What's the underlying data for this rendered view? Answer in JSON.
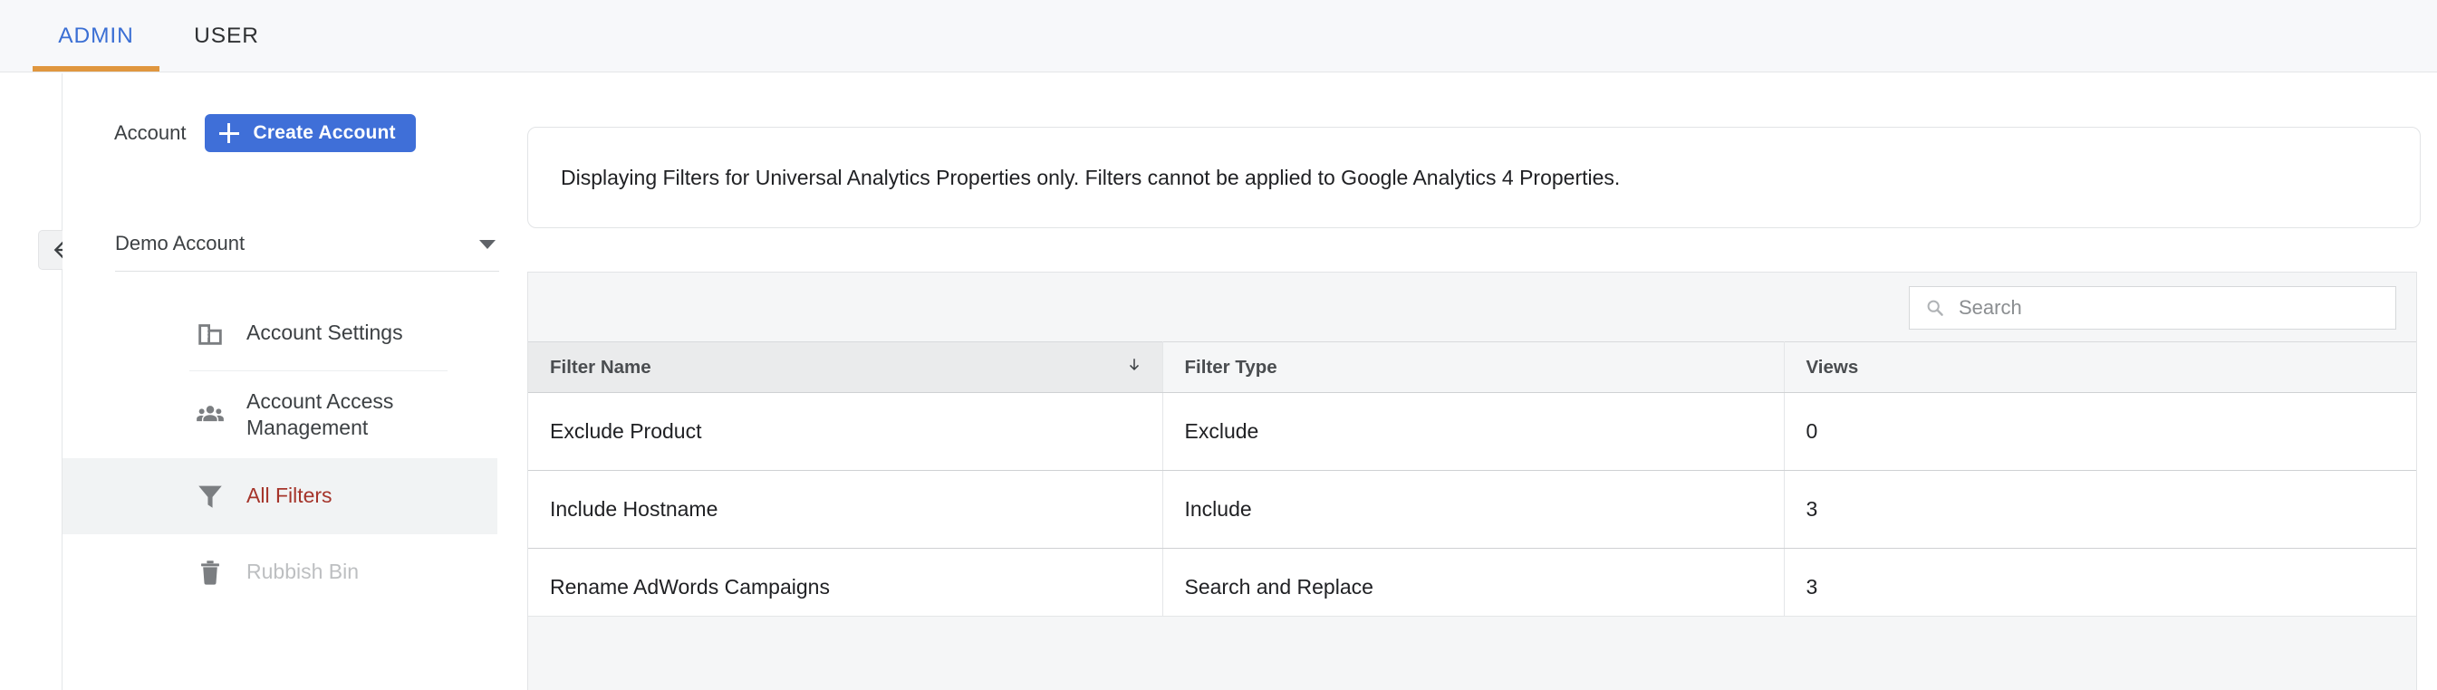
{
  "tabs": [
    {
      "label": "ADMIN",
      "active": true
    },
    {
      "label": "USER",
      "active": false
    }
  ],
  "colors": {
    "tab_active_text": "#3b6fd4",
    "tab_underline": "#e0973f",
    "primary_button": "#3f6fd8",
    "selected_nav_text": "#a5342a",
    "selected_nav_bg": "#f1f3f4",
    "disabled_nav_text": "#bdbfc1"
  },
  "back_button": {
    "icon": "arrow-left-icon"
  },
  "sidebar": {
    "account_label": "Account",
    "create_account_label": "Create Account",
    "create_account_icon": "plus-icon",
    "selected_account": "Demo Account",
    "dropdown_icon": "caret-down-icon",
    "items": [
      {
        "label": "Account Settings",
        "icon": "building-icon",
        "state": "normal"
      },
      {
        "label": "Account Access Management",
        "icon": "people-icon",
        "state": "normal"
      },
      {
        "label": "All Filters",
        "icon": "funnel-icon",
        "state": "selected"
      },
      {
        "label": "Rubbish Bin",
        "icon": "trash-icon",
        "state": "disabled"
      }
    ]
  },
  "main": {
    "banner_text": "Displaying Filters for Universal Analytics Properties only. Filters cannot be applied to Google Analytics 4 Properties.",
    "search": {
      "placeholder": "Search",
      "value": "",
      "icon": "search-icon"
    },
    "table": {
      "columns": [
        {
          "label": "Filter Name",
          "sorted": true,
          "sort_direction": "desc",
          "sort_icon": "arrow-down-icon"
        },
        {
          "label": "Filter Type",
          "sorted": false
        },
        {
          "label": "Views",
          "sorted": false
        }
      ],
      "rows": [
        {
          "filter_name": "Exclude Product",
          "filter_type": "Exclude",
          "views": "0"
        },
        {
          "filter_name": "Include Hostname",
          "filter_type": "Include",
          "views": "3"
        },
        {
          "filter_name": "Rename AdWords Campaigns",
          "filter_type": "Search and Replace",
          "views": "3"
        }
      ]
    }
  }
}
